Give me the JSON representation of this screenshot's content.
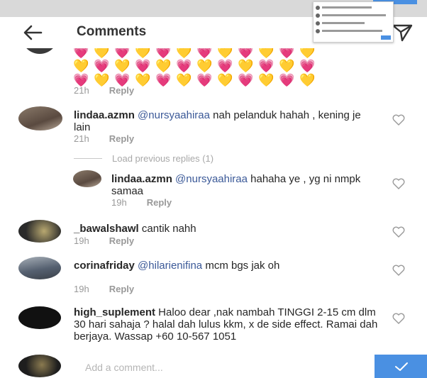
{
  "header": {
    "title": "Comments",
    "back_icon": "back-arrow-icon",
    "send_icon": "paper-plane-icon"
  },
  "emoji_rows": [
    [
      "💗",
      "💛",
      "💗",
      "💛",
      "💗",
      "💛",
      "💗",
      "💛",
      "💗",
      "💛",
      "💗",
      "💛"
    ],
    [
      "💛",
      "💗",
      "💛",
      "💗",
      "💛",
      "💗",
      "💛",
      "💗",
      "💛",
      "💗",
      "💛",
      "💗"
    ],
    [
      "💗",
      "💛",
      "💗",
      "💛",
      "💗",
      "💛",
      "💗",
      "💛",
      "💗",
      "💛",
      "💗",
      "💛"
    ]
  ],
  "first_comment": {
    "time": "21h",
    "reply": "Reply"
  },
  "comments": [
    {
      "username": "lindaa.azmn",
      "mention": "@nursyaahiraa",
      "text": " nah pelanduk hahah , kening je lain",
      "time": "21h",
      "reply": "Reply"
    },
    {
      "username": "lindaa.azmn",
      "mention": "@nursyaahiraa",
      "text": " hahaha ye , yg ni nmpk samaa",
      "time": "19h",
      "reply": "Reply"
    },
    {
      "username": "_bawalshawl",
      "mention": "",
      "text": " cantik nahh",
      "time": "19h",
      "reply": "Reply"
    },
    {
      "username": "corinafriday",
      "mention": "@hilarienifina",
      "text": " mcm bgs jak oh",
      "time": "19h",
      "reply": "Reply"
    },
    {
      "username": "high_suplement",
      "mention": "",
      "text": " Haloo dear ,nak nambah TINGGI  2-15 cm dlm 30 hari sahaja ? halal dah lulus kkm, x de side effect. Ramai dah berjaya. Wassap +60 10-567 1051",
      "time": "",
      "reply": ""
    }
  ],
  "load_previous": "Load previous replies (1)",
  "footer": {
    "placeholder": "Add a comment...",
    "post_icon": "check-icon"
  },
  "colors": {
    "accent": "#4a90e2",
    "mention": "#3b5998",
    "meta": "#999999"
  }
}
